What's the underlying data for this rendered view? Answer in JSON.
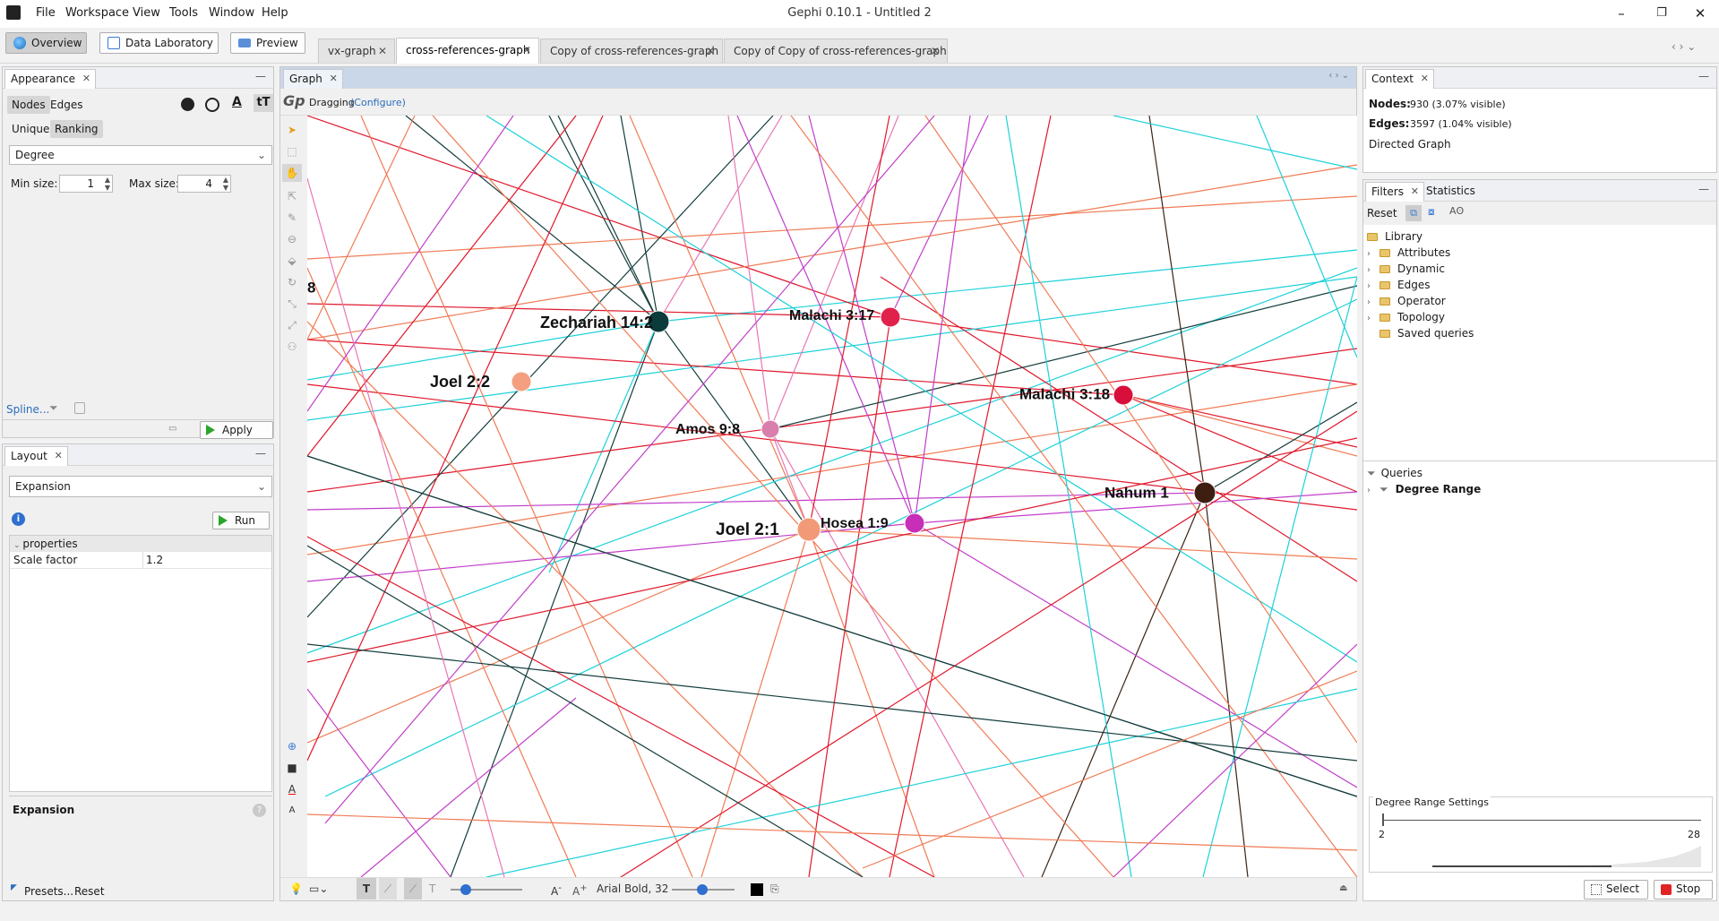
{
  "app": {
    "window_title": "Gephi 0.10.1 - Untitled 2",
    "menu": [
      "File",
      "Workspace",
      "View",
      "Tools",
      "Window",
      "Help"
    ],
    "window_controls": [
      "–",
      "❐",
      "✕"
    ]
  },
  "toolbar": {
    "overview": "Overview",
    "data_laboratory": "Data Laboratory",
    "preview": "Preview",
    "nav_arrows": "‹ › ⌄"
  },
  "tabs": [
    {
      "label": "vx-graph"
    },
    {
      "label": "cross-references-graph"
    },
    {
      "label": "Copy of cross-references-graph"
    },
    {
      "label": "Copy of Copy of cross-references-graph"
    }
  ],
  "appearance": {
    "title": "Appearance",
    "nodes_tab": "Nodes",
    "edges_tab": "Edges",
    "unique": "Unique",
    "ranking": "Ranking",
    "attribute": "Degree",
    "min_size_label": "Min size:",
    "min_size": "1",
    "max_size_label": "Max size:",
    "max_size": "4",
    "spline": "Spline...",
    "apply": "Apply"
  },
  "layout": {
    "title": "Layout",
    "algorithm": "Expansion",
    "run": "Run",
    "properties_header": "properties",
    "property_name": "Scale factor",
    "property_value": "1.2",
    "desc_title": "Expansion",
    "presets": "Presets...",
    "reset": "Reset"
  },
  "graph": {
    "title": "Graph",
    "mode": "Dragging",
    "configure": "(Configure)",
    "font_label": "Arial Bold, 32",
    "nodes": [
      {
        "label": "8",
        "color": "#333333"
      },
      {
        "label": "Zechariah 14:2",
        "color": "#0c3b3b"
      },
      {
        "label": "Malachi 3:17",
        "color": "#e0224a"
      },
      {
        "label": "Joel 2:2",
        "color": "#f4a080"
      },
      {
        "label": "Malachi 3:18",
        "color": "#d80f3a"
      },
      {
        "label": "Amos 9:8",
        "color": "#d97fae"
      },
      {
        "label": "Nahum 1",
        "color": "#3e1e10"
      },
      {
        "label": "Hosea 1:9",
        "color": "#c72fb8"
      },
      {
        "label": "Joel 2:1",
        "color": "#f29a78"
      }
    ],
    "edge_colors": [
      "#f07b55",
      "#e0182c",
      "#1dd1d9",
      "#c13fc9",
      "#143d3d",
      "#3a2516",
      "#e877b4"
    ]
  },
  "context": {
    "title": "Context",
    "nodes_label": "Nodes:",
    "nodes_value": "930 (3.07% visible)",
    "edges_label": "Edges:",
    "edges_value": "3597 (1.04% visible)",
    "graph_type": "Directed Graph"
  },
  "filters": {
    "title": "Filters",
    "statistics": "Statistics",
    "reset": "Reset",
    "library": "Library",
    "items": [
      "Attributes",
      "Dynamic",
      "Edges",
      "Operator",
      "Topology",
      "Saved queries"
    ],
    "queries": "Queries",
    "query_item": "Degree Range",
    "settings_title": "Degree Range Settings",
    "range_min": "2",
    "range_max": "28",
    "select": "Select",
    "stop": "Stop"
  }
}
